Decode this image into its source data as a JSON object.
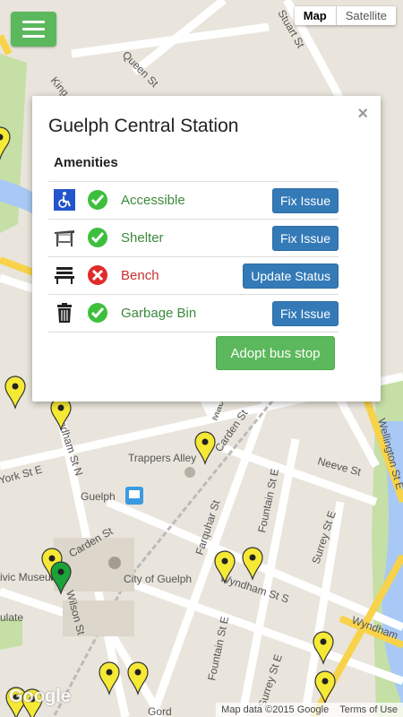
{
  "map_type": {
    "map": "Map",
    "satellite": "Satellite"
  },
  "labels": {
    "queen": "Queen St",
    "stuart": "Stuart St",
    "king": "King",
    "wellington": "Wellington St E",
    "neeve": "Neeve St",
    "wyndham1": "Wyndham St S",
    "wyndham2": "Wyndham",
    "trappers": "Trappers Alley",
    "guelph": "Guelph",
    "carden1": "Carden St",
    "carden2": "Carden St",
    "farquhar": "Farquhar St",
    "fountain1": "Fountain St E",
    "fountain2": "Fountain St E",
    "surrey1": "Surrey St E",
    "surrey2": "Surrey St E",
    "city": "City of Guelph",
    "wilson": "Wilson St",
    "wyndhamN": "Wyndham St N",
    "museum": "ivic Museum",
    "york": "York St E",
    "ulate": "ulate",
    "gordon": "Gord",
    "macdonell": "Macd"
  },
  "popup": {
    "title": "Guelph Central Station",
    "amenities_heading": "Amenities",
    "items": [
      {
        "label": "Accessible",
        "status": "ok",
        "action": "Fix Issue"
      },
      {
        "label": "Shelter",
        "status": "ok",
        "action": "Fix Issue"
      },
      {
        "label": "Bench",
        "status": "bad",
        "action": "Update Status"
      },
      {
        "label": "Garbage Bin",
        "status": "ok",
        "action": "Fix Issue"
      }
    ],
    "adopt_label": "Adopt bus stop",
    "close_symbol": "×"
  },
  "footer": {
    "google": "Google",
    "map_data": "Map data ©2015 Google",
    "terms": "Terms of Use"
  },
  "colors": {
    "accent_green": "#5cb85c",
    "button_blue": "#337ab7",
    "ok_green": "#3c8a3c",
    "bad_red": "#c9302c",
    "pin_yellow": "#f5e935",
    "pin_green": "#1aa33a"
  }
}
